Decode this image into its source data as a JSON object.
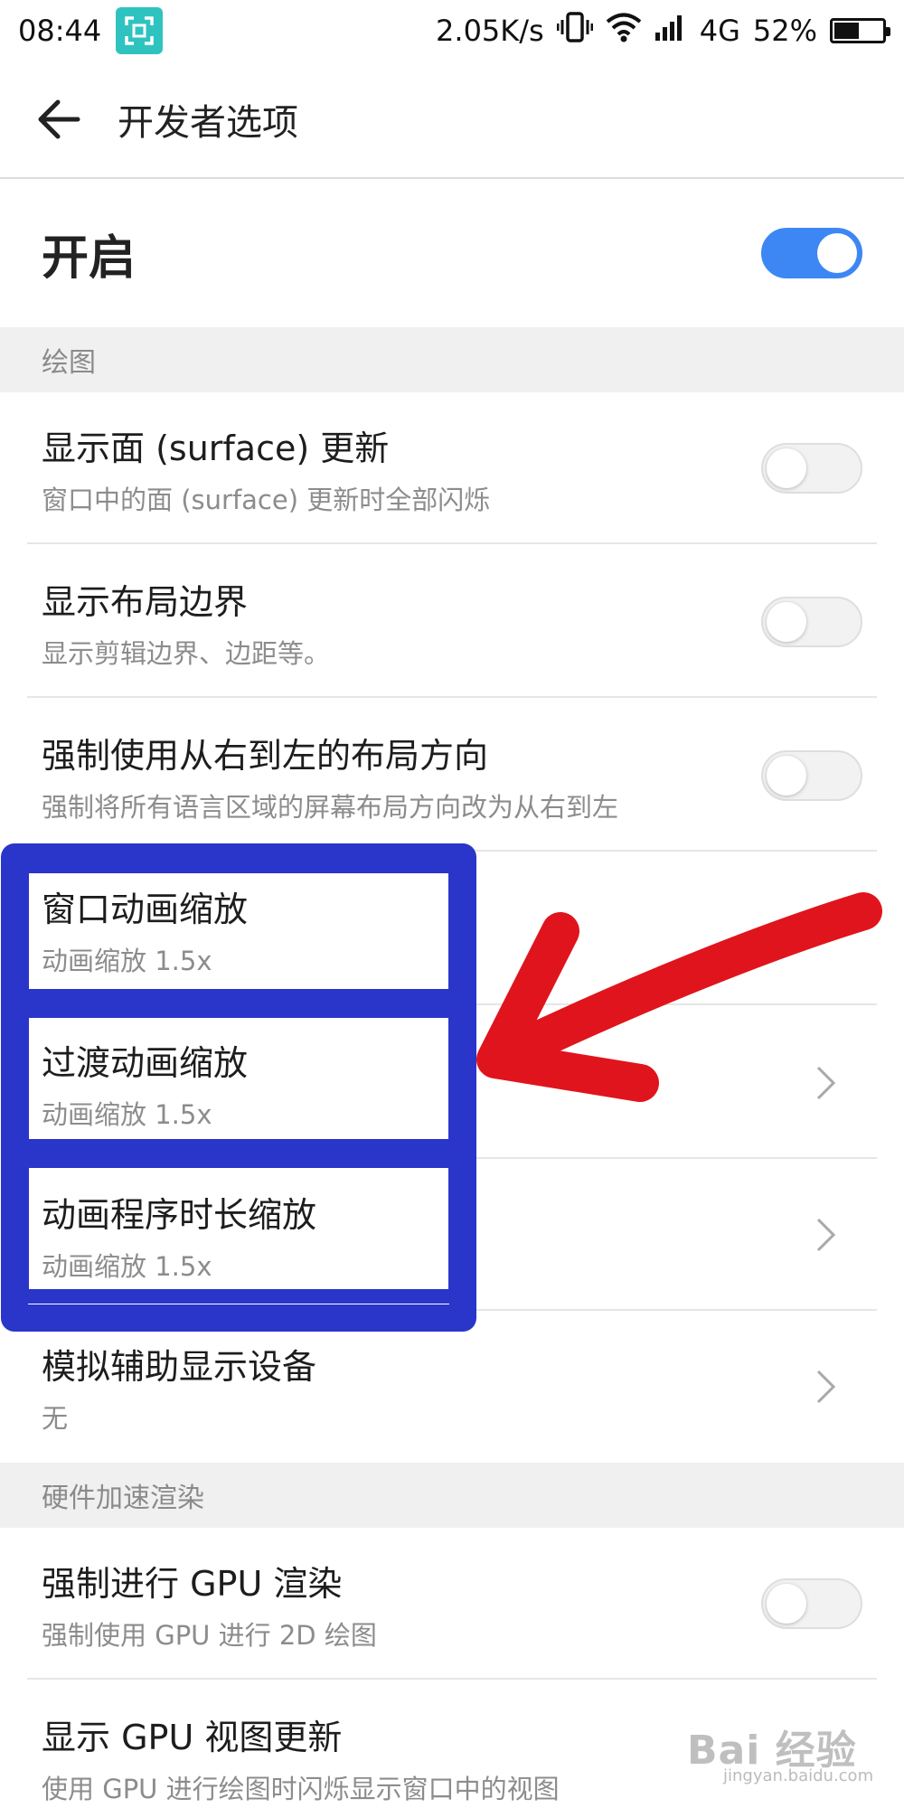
{
  "status_bar": {
    "time": "08:44",
    "network_speed": "2.05K/s",
    "network_type": "4G",
    "battery_percent_text": "52%",
    "battery_level": 0.52,
    "icons": [
      "screenshot-icon",
      "vibrate-icon",
      "wifi-icon",
      "signal-icon",
      "battery-icon"
    ]
  },
  "header": {
    "back_icon": "arrow-left-icon",
    "title": "开发者选项"
  },
  "master_switch": {
    "label": "开启",
    "enabled": true,
    "on_color": "#3d87f5"
  },
  "sections": {
    "drawing": {
      "header": "绘图",
      "items": [
        {
          "title": "显示面 (surface) 更新",
          "subtitle": "窗口中的面 (surface) 更新时全部闪烁",
          "control": "toggle",
          "enabled": false
        },
        {
          "title": "显示布局边界",
          "subtitle": "显示剪辑边界、边距等。",
          "control": "toggle",
          "enabled": false
        },
        {
          "title": "强制使用从右到左的布局方向",
          "subtitle": "强制将所有语言区域的屏幕布局方向改为从右到左",
          "control": "toggle",
          "enabled": false
        },
        {
          "title": "窗口动画缩放",
          "subtitle": "动画缩放 1.5x",
          "control": "chevron"
        },
        {
          "title": "过渡动画缩放",
          "subtitle": "动画缩放 1.5x",
          "control": "chevron"
        },
        {
          "title": "动画程序时长缩放",
          "subtitle": "动画缩放 1.5x",
          "control": "chevron"
        },
        {
          "title": "模拟辅助显示设备",
          "subtitle": "无",
          "control": "chevron"
        }
      ]
    },
    "hardware": {
      "header": "硬件加速渲染",
      "items": [
        {
          "title": "强制进行 GPU 渲染",
          "subtitle": "强制使用 GPU 进行 2D 绘图",
          "control": "toggle",
          "enabled": false
        },
        {
          "title": "显示 GPU 视图更新",
          "subtitle": "使用 GPU 进行绘图时闪烁显示窗口中的视图",
          "control": "none"
        }
      ]
    }
  },
  "annotations": {
    "highlight_box_color": "#2a35c9",
    "arrow_color": "#e0141c"
  },
  "watermark": {
    "logo": "Bai 经验",
    "sub": "jingyan.baidu.com"
  }
}
